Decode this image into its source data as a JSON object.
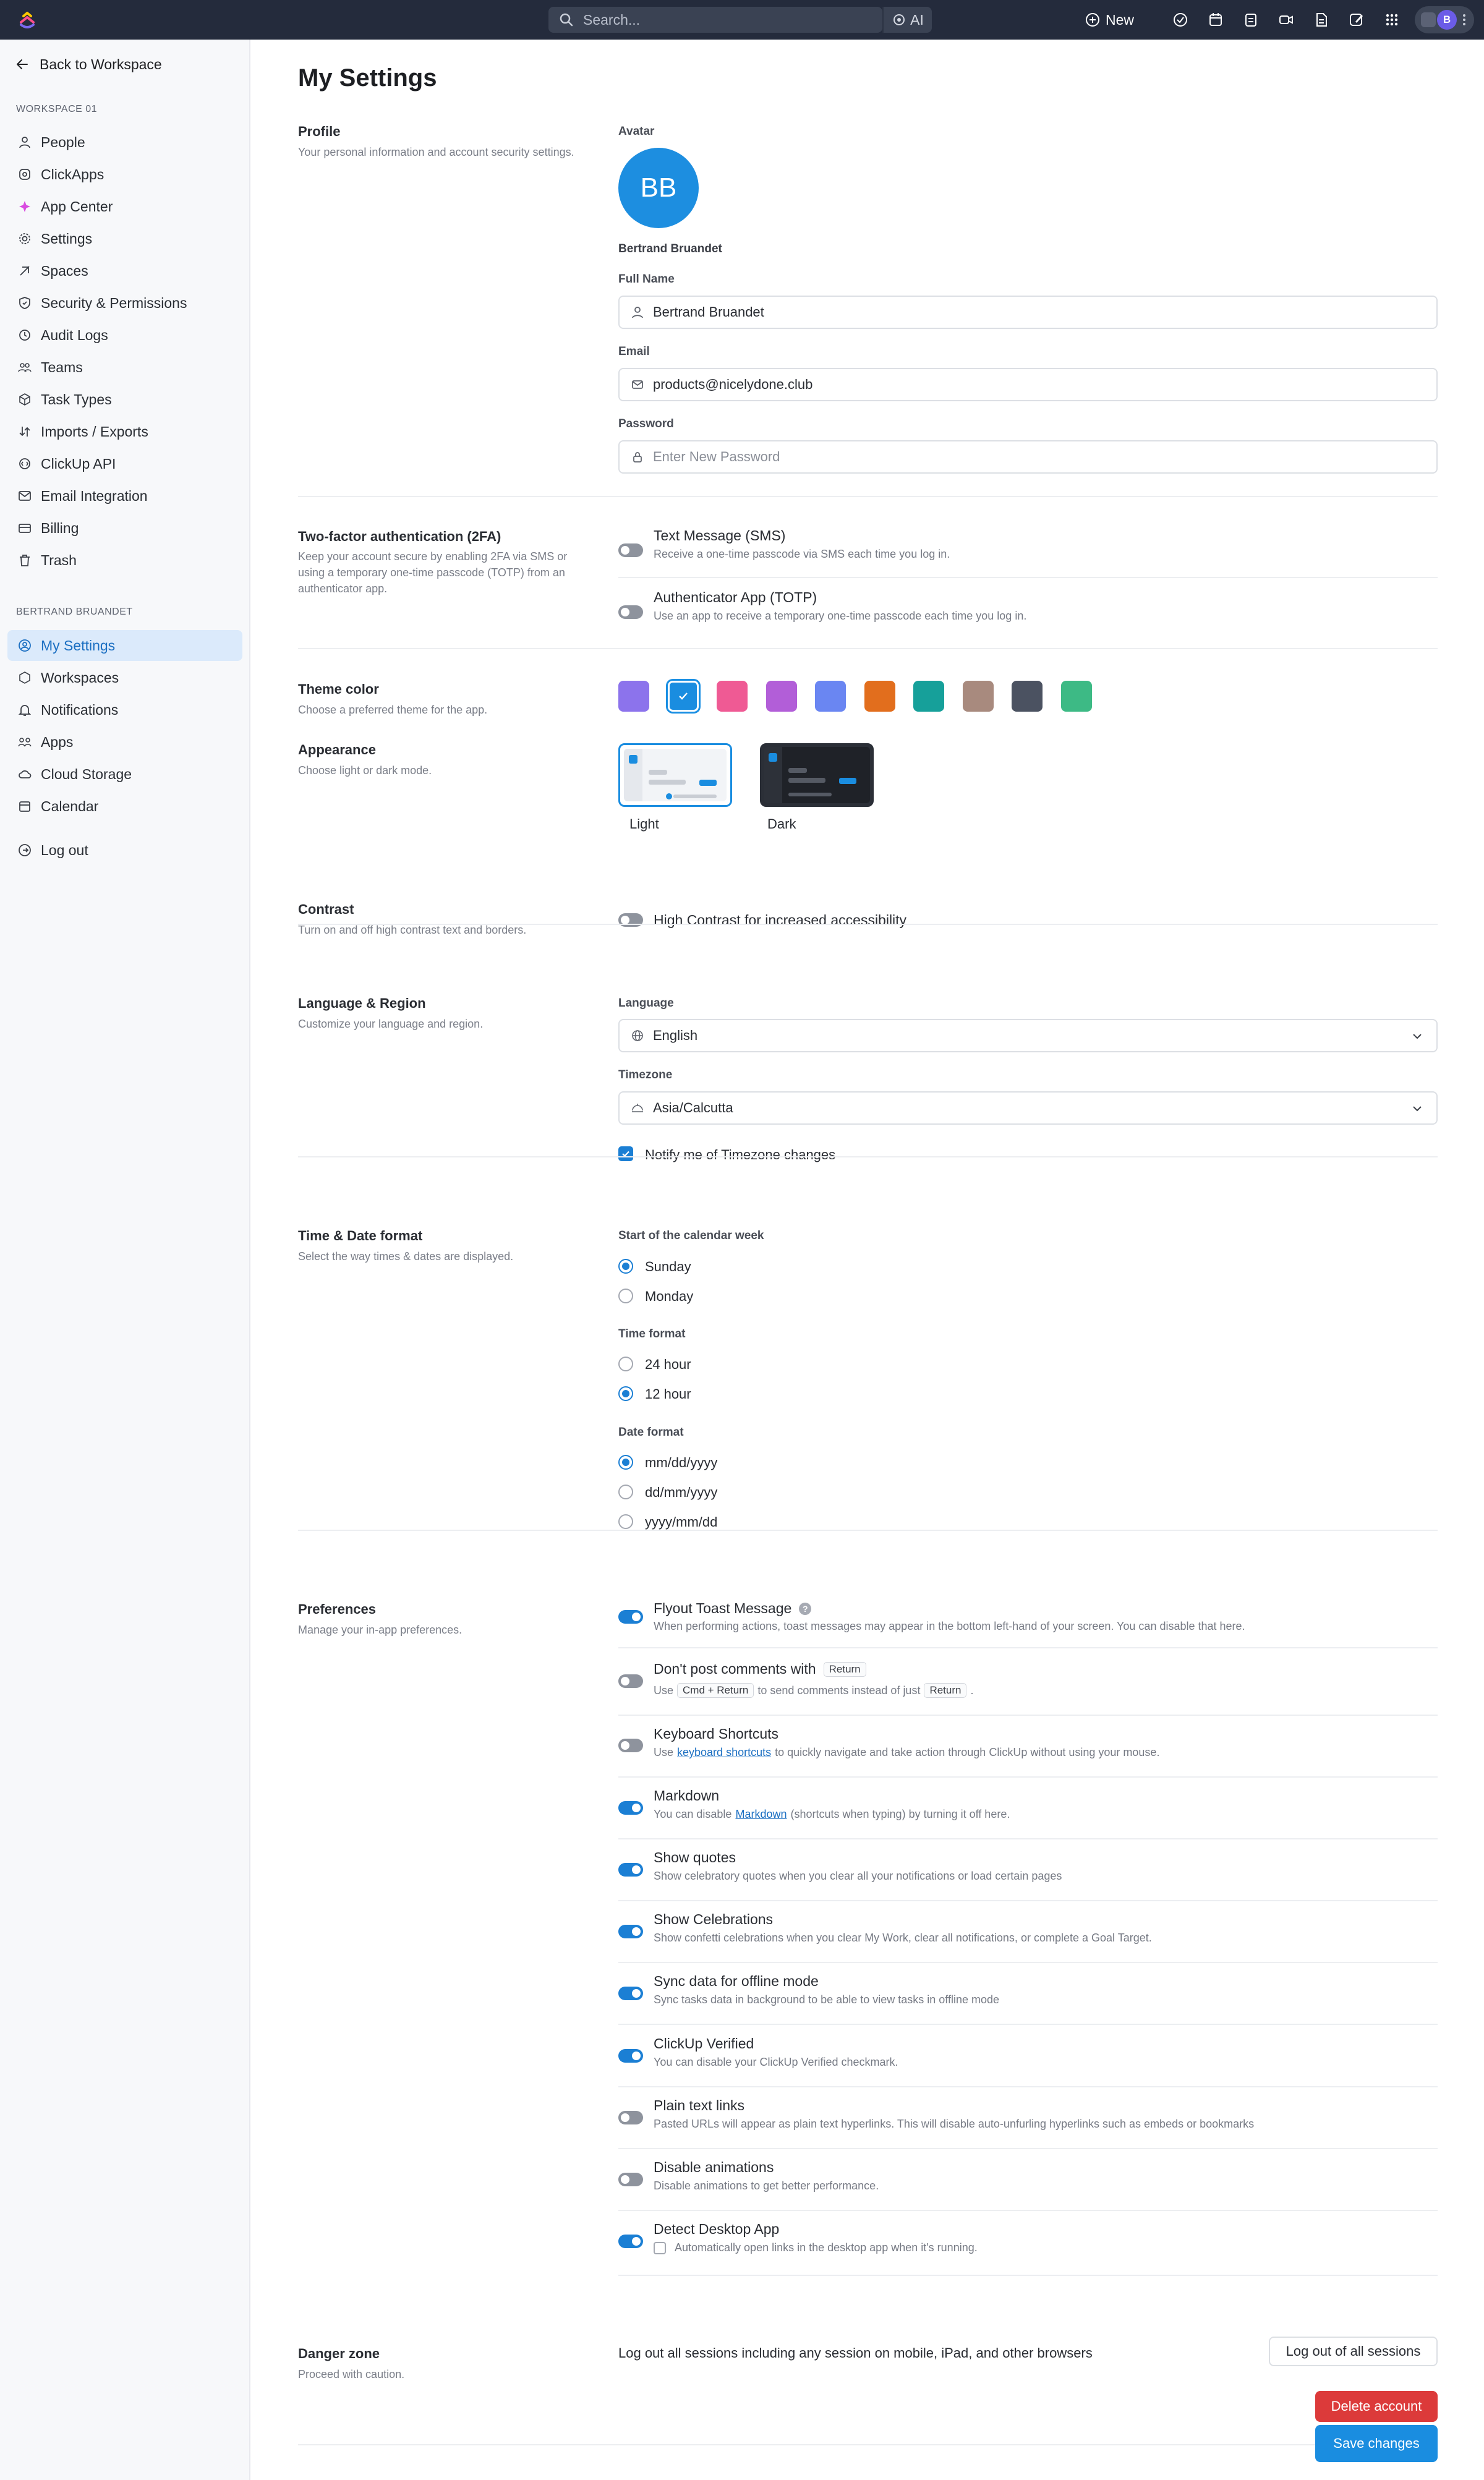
{
  "colors": {
    "accent": "#1a8de0",
    "topbar": "#242b3c",
    "danger": "#dc3a3a"
  },
  "topbar": {
    "search_placeholder": "Search...",
    "ai_label": "AI",
    "new_label": "New",
    "profile_initial": "B",
    "icons": [
      "check-circle-icon",
      "calendar-icon",
      "clipboard-icon",
      "video-icon",
      "document-icon",
      "edit-icon",
      "grid-icon"
    ]
  },
  "sidebar": {
    "back_label": "Back to Workspace",
    "workspace_header": "WORKSPACE 01",
    "workspace_items": [
      {
        "label": "People",
        "icon": "person-icon"
      },
      {
        "label": "ClickApps",
        "icon": "clickapps-icon"
      },
      {
        "label": "App Center",
        "icon": "app-center-icon"
      },
      {
        "label": "Settings",
        "icon": "gear-icon"
      },
      {
        "label": "Spaces",
        "icon": "spaces-icon"
      },
      {
        "label": "Security & Permissions",
        "icon": "shield-icon"
      },
      {
        "label": "Audit Logs",
        "icon": "audit-icon"
      },
      {
        "label": "Teams",
        "icon": "teams-icon"
      },
      {
        "label": "Task Types",
        "icon": "cube-icon"
      },
      {
        "label": "Imports / Exports",
        "icon": "import-export-icon"
      },
      {
        "label": "ClickUp API",
        "icon": "api-icon"
      },
      {
        "label": "Email Integration",
        "icon": "mail-icon"
      },
      {
        "label": "Billing",
        "icon": "billing-icon"
      },
      {
        "label": "Trash",
        "icon": "trash-icon"
      }
    ],
    "user_header": "BERTRAND BRUANDET",
    "user_items": [
      {
        "label": "My Settings",
        "icon": "user-circle-icon",
        "active": true
      },
      {
        "label": "Workspaces",
        "icon": "workspaces-icon"
      },
      {
        "label": "Notifications",
        "icon": "bell-icon"
      },
      {
        "label": "Apps",
        "icon": "apps-icon"
      },
      {
        "label": "Cloud Storage",
        "icon": "cloud-icon"
      },
      {
        "label": "Calendar",
        "icon": "calendar-icon"
      }
    ],
    "logout_label": "Log out"
  },
  "main": {
    "page_title": "My Settings",
    "profile": {
      "title": "Profile",
      "desc": "Your personal information and account security settings.",
      "avatar_label": "Avatar",
      "avatar_initials": "BB",
      "name": "Bertrand Bruandet",
      "full_name_label": "Full Name",
      "full_name_value": "Bertrand Bruandet",
      "email_label": "Email",
      "email_value": "products@nicelydone.club",
      "password_label": "Password",
      "password_placeholder": "Enter New Password"
    },
    "twofa": {
      "title": "Two-factor authentication (2FA)",
      "desc": "Keep your account secure by enabling 2FA via SMS or using a temporary one-time passcode (TOTP) from an authenticator app.",
      "options": [
        {
          "title": "Text Message (SMS)",
          "desc": "Receive a one-time passcode via SMS each time you log in.",
          "on": false
        },
        {
          "title": "Authenticator App (TOTP)",
          "desc": "Use an app to receive a temporary one-time passcode each time you log in.",
          "on": false
        }
      ]
    },
    "theme": {
      "title": "Theme color",
      "desc": "Choose a preferred theme for the app.",
      "swatches": [
        "#8c73ec",
        "#1a8de0",
        "#ef5a94",
        "#b25ed8",
        "#6a86f2",
        "#e26e1d",
        "#16a09a",
        "#a88a7e",
        "#4b5261",
        "#3dba85"
      ],
      "selected_index": 1
    },
    "appearance": {
      "title": "Appearance",
      "desc": "Choose light or dark mode.",
      "light_label": "Light",
      "dark_label": "Dark",
      "selected": "Light"
    },
    "contrast": {
      "title": "Contrast",
      "desc": "Turn on and off high contrast text and borders.",
      "toggle_label": "High Contrast for increased accessibility",
      "on": false
    },
    "language": {
      "title": "Language & Region",
      "desc": "Customize your language and region.",
      "language_label": "Language",
      "language_value": "English",
      "timezone_label": "Timezone",
      "timezone_value": "Asia/Calcutta",
      "notify_label": "Notify me of Timezone changes",
      "notify_checked": true
    },
    "datetime": {
      "title": "Time & Date format",
      "desc": "Select the way times & dates are displayed.",
      "week_label": "Start of the calendar week",
      "week_options": [
        "Sunday",
        "Monday"
      ],
      "week_selected": "Sunday",
      "time_label": "Time format",
      "time_options": [
        "24 hour",
        "12 hour"
      ],
      "time_selected": "12 hour",
      "date_label": "Date format",
      "date_options": [
        "mm/dd/yyyy",
        "dd/mm/yyyy",
        "yyyy/mm/dd"
      ],
      "date_selected": "mm/dd/yyyy"
    },
    "preferences": {
      "title": "Preferences",
      "desc": "Manage your in-app preferences.",
      "flyout": {
        "title": "Flyout Toast Message",
        "desc": "When performing actions, toast messages may appear in the bottom left-hand of your screen. You can disable that here.",
        "on": true
      },
      "comments": {
        "title": "Don't post comments with",
        "title_key": "Return",
        "desc_1": "Use",
        "desc_key_1": "Cmd + Return",
        "desc_2": "to send comments instead of just",
        "desc_key_2": "Return",
        "desc_3": ".",
        "on": false
      },
      "shortcuts": {
        "title": "Keyboard Shortcuts",
        "desc_1": "Use",
        "desc_link": "keyboard shortcuts",
        "desc_2": "to quickly navigate and take action through ClickUp without using your mouse.",
        "on": false
      },
      "markdown": {
        "title": "Markdown",
        "desc_1": "You can disable",
        "desc_link": "Markdown",
        "desc_2": "(shortcuts when typing) by turning it off here.",
        "on": true
      },
      "quotes": {
        "title": "Show quotes",
        "desc": "Show celebratory quotes when you clear all your notifications or load certain pages",
        "on": true
      },
      "celebrations": {
        "title": "Show Celebrations",
        "desc": "Show confetti celebrations when you clear My Work, clear all notifications, or complete a Goal Target.",
        "on": true
      },
      "offline": {
        "title": "Sync data for offline mode",
        "desc": "Sync tasks data in background to be able to view tasks in offline mode",
        "on": true
      },
      "verified": {
        "title": "ClickUp Verified",
        "desc": "You can disable your ClickUp Verified checkmark.",
        "on": true
      },
      "plainlinks": {
        "title": "Plain text links",
        "desc": "Pasted URLs will appear as plain text hyperlinks. This will disable auto-unfurling hyperlinks such as embeds or bookmarks",
        "on": false
      },
      "animations": {
        "title": "Disable animations",
        "desc": "Disable animations to get better performance.",
        "on": false
      },
      "desktop": {
        "title": "Detect Desktop App",
        "desc": "Automatically open links in the desktop app when it's running.",
        "on": true,
        "checked": false
      }
    },
    "danger": {
      "title": "Danger zone",
      "desc": "Proceed with caution.",
      "sessions_text": "Log out all sessions including any session on mobile, iPad, and other browsers",
      "logout_all_label": "Log out of all sessions",
      "delete_label": "Delete account"
    },
    "save_label": "Save changes"
  }
}
